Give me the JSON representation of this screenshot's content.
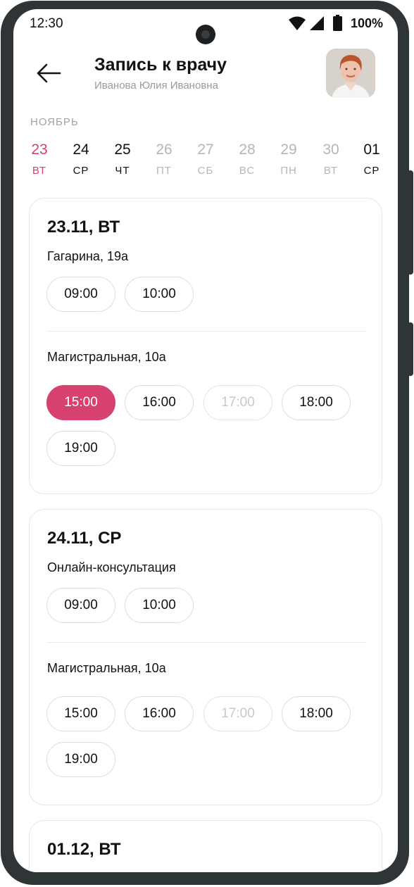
{
  "status_bar": {
    "time": "12:30",
    "battery": "100%"
  },
  "header": {
    "title": "Запись к врачу",
    "subtitle": "Иванова Юлия Ивановна"
  },
  "calendar": {
    "month": "НОЯБРЬ",
    "days": [
      {
        "num": "23",
        "dow": "ВТ",
        "state": "selected"
      },
      {
        "num": "24",
        "dow": "СР",
        "state": "available"
      },
      {
        "num": "25",
        "dow": "ЧТ",
        "state": "available"
      },
      {
        "num": "26",
        "dow": "ПТ",
        "state": "disabled"
      },
      {
        "num": "27",
        "dow": "СБ",
        "state": "disabled"
      },
      {
        "num": "28",
        "dow": "ВС",
        "state": "disabled"
      },
      {
        "num": "29",
        "dow": "ПН",
        "state": "disabled"
      },
      {
        "num": "30",
        "dow": "ВТ",
        "state": "disabled"
      },
      {
        "num": "01",
        "dow": "СР",
        "state": "available"
      }
    ]
  },
  "cards": [
    {
      "date": "23.11, ВТ",
      "locations": [
        {
          "name": "Гагарина, 19а",
          "slots": [
            {
              "time": "09:00"
            },
            {
              "time": "10:00"
            }
          ]
        },
        {
          "name": "Магистральная, 10а",
          "slots": [
            {
              "time": "15:00",
              "state": "selected"
            },
            {
              "time": "16:00"
            },
            {
              "time": "17:00",
              "state": "disabled"
            },
            {
              "time": "18:00"
            },
            {
              "time": "19:00"
            }
          ]
        }
      ]
    },
    {
      "date": "24.11, СР",
      "locations": [
        {
          "name": "Онлайн-консультация",
          "slots": [
            {
              "time": "09:00"
            },
            {
              "time": "10:00"
            }
          ]
        },
        {
          "name": "Магистральная, 10а",
          "slots": [
            {
              "time": "15:00"
            },
            {
              "time": "16:00"
            },
            {
              "time": "17:00",
              "state": "disabled"
            },
            {
              "time": "18:00"
            },
            {
              "time": "19:00"
            }
          ]
        }
      ]
    },
    {
      "date": "01.12, ВТ"
    }
  ],
  "colors": {
    "accent": "#d7416f",
    "frame": "#2f3437",
    "muted": "#b6b6b6"
  }
}
